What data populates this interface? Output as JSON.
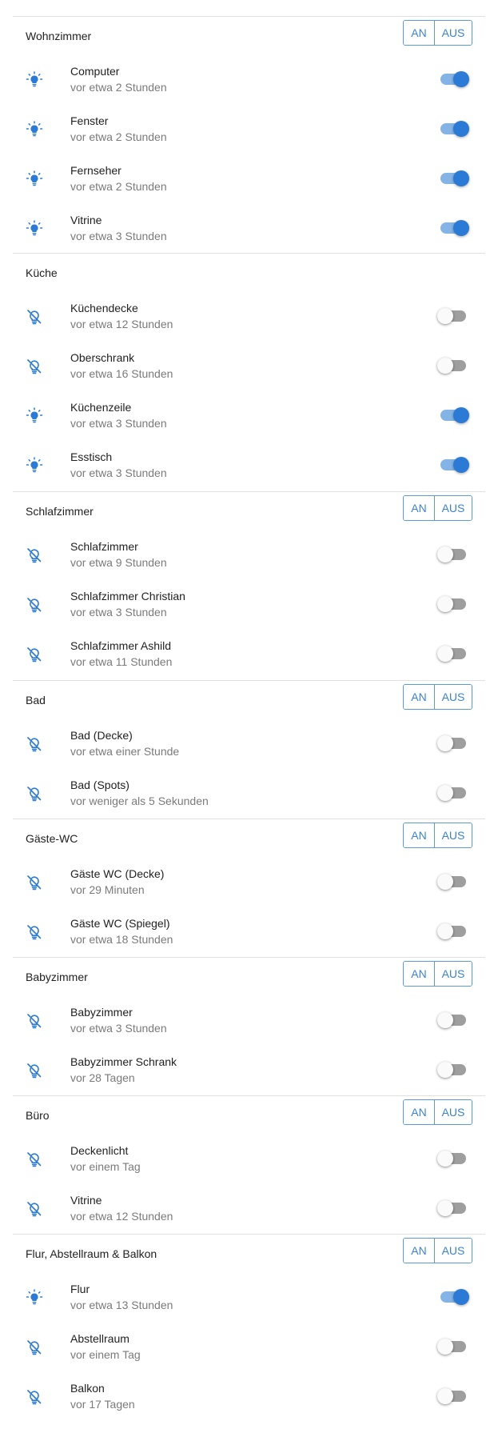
{
  "colors": {
    "accent": "#2a7ad6",
    "icon": "#2a7ad6",
    "muted_text": "#7a7a7a",
    "divider": "#e0e0e0"
  },
  "rooms": [
    {
      "title": "Wohnzimmer",
      "has_group_buttons": true,
      "on_label": "AN",
      "off_label": "AUS",
      "lights": [
        {
          "name": "Computer",
          "time": "vor etwa 2 Stunden",
          "state": true,
          "icon": "lightbulb-on-icon"
        },
        {
          "name": "Fenster",
          "time": "vor etwa 2 Stunden",
          "state": true,
          "icon": "lightbulb-on-icon"
        },
        {
          "name": "Fernseher",
          "time": "vor etwa 2 Stunden",
          "state": true,
          "icon": "lightbulb-on-icon"
        },
        {
          "name": "Vitrine",
          "time": "vor etwa 3 Stunden",
          "state": true,
          "icon": "lightbulb-on-icon"
        }
      ]
    },
    {
      "title": "Küche",
      "has_group_buttons": false,
      "lights": [
        {
          "name": "Küchendecke",
          "time": "vor etwa 12 Stunden",
          "state": false,
          "icon": "lightbulb-off-icon"
        },
        {
          "name": "Oberschrank",
          "time": "vor etwa 16 Stunden",
          "state": false,
          "icon": "lightbulb-off-icon"
        },
        {
          "name": "Küchenzeile",
          "time": "vor etwa 3 Stunden",
          "state": true,
          "icon": "lightbulb-on-icon"
        },
        {
          "name": "Esstisch",
          "time": "vor etwa 3 Stunden",
          "state": true,
          "icon": "lightbulb-on-icon"
        }
      ]
    },
    {
      "title": "Schlafzimmer",
      "has_group_buttons": true,
      "on_label": "AN",
      "off_label": "AUS",
      "lights": [
        {
          "name": "Schlafzimmer",
          "time": "vor etwa 9 Stunden",
          "state": false,
          "icon": "lightbulb-off-icon"
        },
        {
          "name": "Schlafzimmer Christian",
          "time": "vor etwa 3 Stunden",
          "state": false,
          "icon": "lightbulb-off-icon"
        },
        {
          "name": "Schlafzimmer Ashild",
          "time": "vor etwa 11 Stunden",
          "state": false,
          "icon": "lightbulb-off-icon"
        }
      ]
    },
    {
      "title": "Bad",
      "has_group_buttons": true,
      "on_label": "AN",
      "off_label": "AUS",
      "lights": [
        {
          "name": "Bad (Decke)",
          "time": "vor etwa einer Stunde",
          "state": false,
          "icon": "lightbulb-off-icon"
        },
        {
          "name": "Bad (Spots)",
          "time": "vor weniger als 5 Sekunden",
          "state": false,
          "icon": "lightbulb-off-icon"
        }
      ]
    },
    {
      "title": "Gäste-WC",
      "has_group_buttons": true,
      "on_label": "AN",
      "off_label": "AUS",
      "lights": [
        {
          "name": "Gäste WC (Decke)",
          "time": "vor 29 Minuten",
          "state": false,
          "icon": "lightbulb-off-icon"
        },
        {
          "name": "Gäste WC (Spiegel)",
          "time": "vor etwa 18 Stunden",
          "state": false,
          "icon": "lightbulb-off-icon"
        }
      ]
    },
    {
      "title": "Babyzimmer",
      "has_group_buttons": true,
      "on_label": "AN",
      "off_label": "AUS",
      "lights": [
        {
          "name": "Babyzimmer",
          "time": "vor etwa 3 Stunden",
          "state": false,
          "icon": "lightbulb-off-icon"
        },
        {
          "name": "Babyzimmer Schrank",
          "time": "vor 28 Tagen",
          "state": false,
          "icon": "lightbulb-off-icon"
        }
      ]
    },
    {
      "title": "Büro",
      "has_group_buttons": true,
      "on_label": "AN",
      "off_label": "AUS",
      "lights": [
        {
          "name": "Deckenlicht",
          "time": "vor einem Tag",
          "state": false,
          "icon": "lightbulb-off-icon"
        },
        {
          "name": "Vitrine",
          "time": "vor etwa 12 Stunden",
          "state": false,
          "icon": "lightbulb-off-icon"
        }
      ]
    },
    {
      "title": "Flur, Abstellraum & Balkon",
      "has_group_buttons": true,
      "on_label": "AN",
      "off_label": "AUS",
      "lights": [
        {
          "name": "Flur",
          "time": "vor etwa 13 Stunden",
          "state": true,
          "icon": "lightbulb-on-icon"
        },
        {
          "name": "Abstellraum",
          "time": "vor einem Tag",
          "state": false,
          "icon": "lightbulb-off-icon"
        },
        {
          "name": "Balkon",
          "time": "vor 17 Tagen",
          "state": false,
          "icon": "lightbulb-off-icon"
        }
      ]
    }
  ]
}
